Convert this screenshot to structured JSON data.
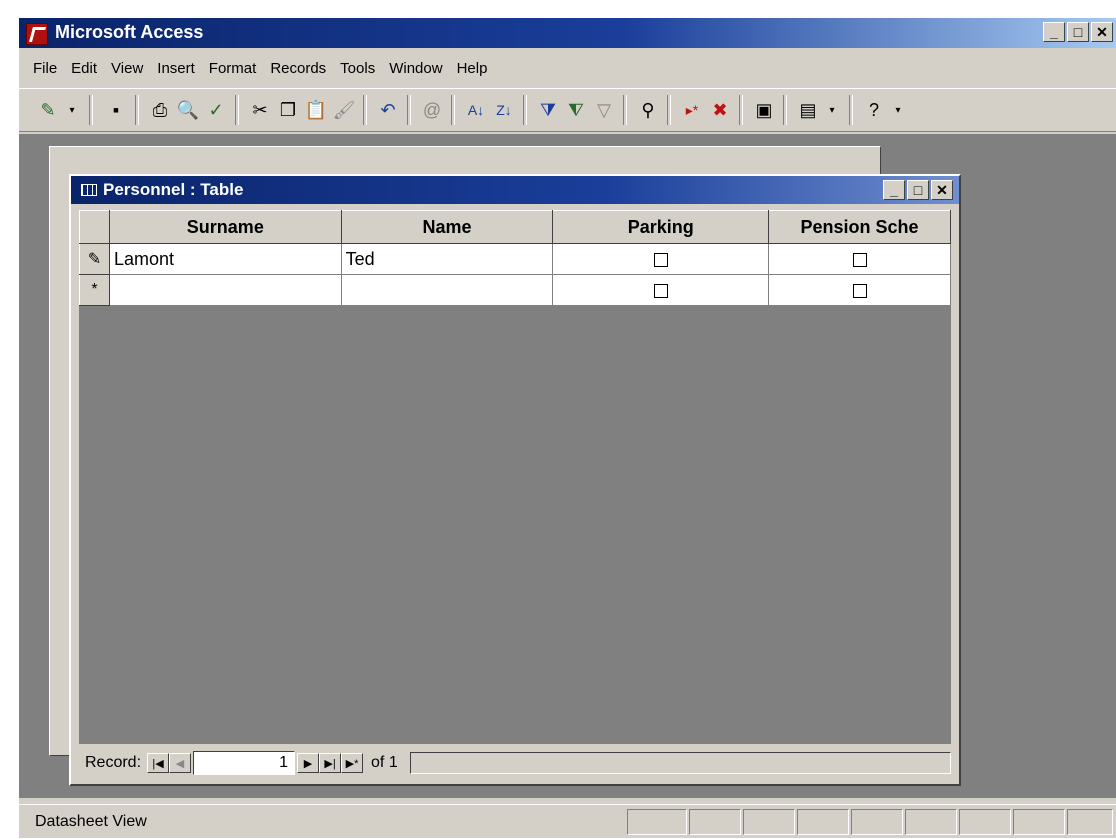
{
  "app": {
    "title": "Microsoft Access"
  },
  "menu": [
    "File",
    "Edit",
    "View",
    "Insert",
    "Format",
    "Records",
    "Tools",
    "Window",
    "Help"
  ],
  "toolbar_icons": [
    "view-icon",
    "save-icon",
    "print-icon",
    "print-preview-icon",
    "spelling-icon",
    "cut-icon",
    "copy-icon",
    "paste-icon",
    "format-painter-icon",
    "undo-icon",
    "hyperlink-icon",
    "sort-ascending-icon",
    "sort-descending-icon",
    "filter-by-selection-icon",
    "filter-by-form-icon",
    "apply-filter-icon",
    "find-icon",
    "new-record-icon",
    "delete-record-icon",
    "properties-icon",
    "new-object-icon",
    "help-icon"
  ],
  "table_window": {
    "title": "Personnel : Table",
    "columns": [
      "Surname",
      "Name",
      "Parking",
      "Pension Sche"
    ],
    "rows": [
      {
        "selector": "✎",
        "surname": "Lamont",
        "name": "Ted",
        "parking": false,
        "pension": false
      },
      {
        "selector": "*",
        "surname": "",
        "name": "",
        "parking": false,
        "pension": false
      }
    ]
  },
  "navigation": {
    "label": "Record:",
    "current": "1",
    "of_text": "of 1"
  },
  "status": {
    "text": "Datasheet View"
  }
}
